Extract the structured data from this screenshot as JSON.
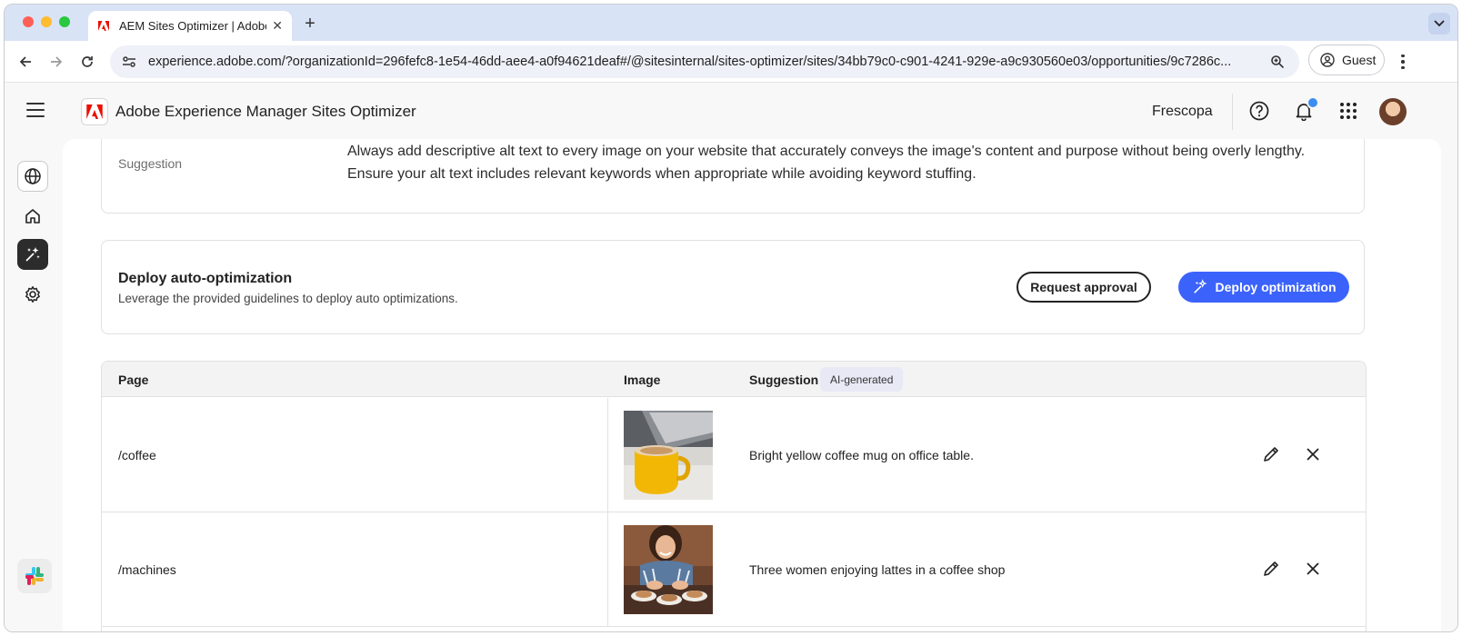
{
  "browser": {
    "tab_title": "AEM Sites Optimizer | Adobe",
    "url_host": "experience.adobe.com",
    "url_rest": "/?organizationId=296fefc8-1e54-46dd-aee4-a0f94621deaf#/@sitesinternal/sites-optimizer/sites/34bb79c0-c901-4241-929e-a9c930560e03/opportunities/9c7286c...",
    "profile_label": "Guest"
  },
  "header": {
    "app_title": "Adobe Experience Manager Sites Optimizer",
    "org_name": "Frescopa"
  },
  "suggestion_card": {
    "label": "Suggestion",
    "text": "Always add descriptive alt text to every image on your website that accurately conveys the image's content and purpose without being overly lengthy. Ensure your alt text includes relevant keywords when appropriate while avoiding keyword stuffing."
  },
  "deploy_card": {
    "title": "Deploy auto-optimization",
    "subtitle": "Leverage the provided guidelines to deploy auto optimizations.",
    "request_label": "Request approval",
    "deploy_label": "Deploy optimization"
  },
  "table": {
    "headers": {
      "page": "Page",
      "image": "Image",
      "suggestion": "Suggestion",
      "badge": "AI-generated"
    },
    "rows": [
      {
        "page": "/coffee",
        "suggestion": "Bright yellow coffee mug on office table."
      },
      {
        "page": "/machines",
        "suggestion": "Three women enjoying lattes in a coffee shop"
      }
    ]
  },
  "colors": {
    "accent": "#3b63fb",
    "adobe_red": "#eb1000",
    "notification": "#3b8ef0"
  }
}
